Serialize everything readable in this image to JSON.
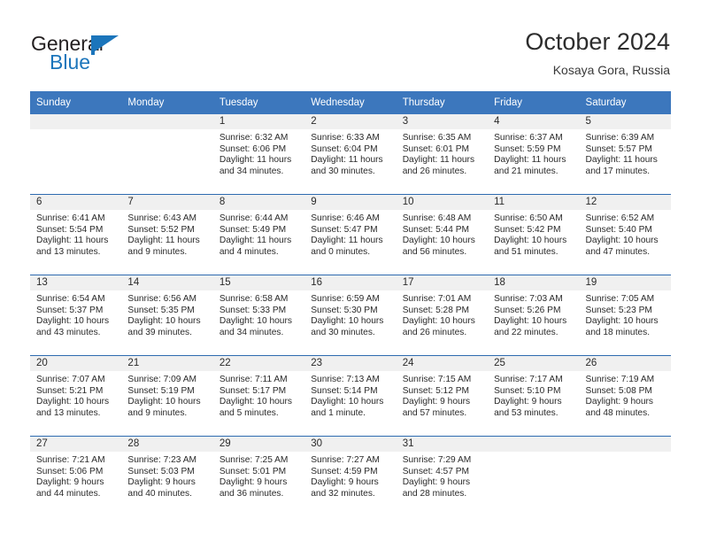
{
  "brand": {
    "name_top": "General",
    "name_bottom": "Blue",
    "flag_icon": "blue-flag-triangle",
    "color": "#1b75bb"
  },
  "header": {
    "title": "October 2024",
    "subtitle": "Kosaya Gora, Russia"
  },
  "theme": {
    "header_blue": "#3c77bd",
    "rule_blue": "#2e6bb0",
    "daynum_band": "#f0f0f0"
  },
  "weekday_headers": [
    "Sunday",
    "Monday",
    "Tuesday",
    "Wednesday",
    "Thursday",
    "Friday",
    "Saturday"
  ],
  "weeks": [
    [
      {
        "day": "",
        "empty": true
      },
      {
        "day": "",
        "empty": true
      },
      {
        "day": "1",
        "sunrise": "Sunrise: 6:32 AM",
        "sunset": "Sunset: 6:06 PM",
        "daylight": "Daylight: 11 hours and 34 minutes."
      },
      {
        "day": "2",
        "sunrise": "Sunrise: 6:33 AM",
        "sunset": "Sunset: 6:04 PM",
        "daylight": "Daylight: 11 hours and 30 minutes."
      },
      {
        "day": "3",
        "sunrise": "Sunrise: 6:35 AM",
        "sunset": "Sunset: 6:01 PM",
        "daylight": "Daylight: 11 hours and 26 minutes."
      },
      {
        "day": "4",
        "sunrise": "Sunrise: 6:37 AM",
        "sunset": "Sunset: 5:59 PM",
        "daylight": "Daylight: 11 hours and 21 minutes."
      },
      {
        "day": "5",
        "sunrise": "Sunrise: 6:39 AM",
        "sunset": "Sunset: 5:57 PM",
        "daylight": "Daylight: 11 hours and 17 minutes."
      }
    ],
    [
      {
        "day": "6",
        "sunrise": "Sunrise: 6:41 AM",
        "sunset": "Sunset: 5:54 PM",
        "daylight": "Daylight: 11 hours and 13 minutes."
      },
      {
        "day": "7",
        "sunrise": "Sunrise: 6:43 AM",
        "sunset": "Sunset: 5:52 PM",
        "daylight": "Daylight: 11 hours and 9 minutes."
      },
      {
        "day": "8",
        "sunrise": "Sunrise: 6:44 AM",
        "sunset": "Sunset: 5:49 PM",
        "daylight": "Daylight: 11 hours and 4 minutes."
      },
      {
        "day": "9",
        "sunrise": "Sunrise: 6:46 AM",
        "sunset": "Sunset: 5:47 PM",
        "daylight": "Daylight: 11 hours and 0 minutes."
      },
      {
        "day": "10",
        "sunrise": "Sunrise: 6:48 AM",
        "sunset": "Sunset: 5:44 PM",
        "daylight": "Daylight: 10 hours and 56 minutes."
      },
      {
        "day": "11",
        "sunrise": "Sunrise: 6:50 AM",
        "sunset": "Sunset: 5:42 PM",
        "daylight": "Daylight: 10 hours and 51 minutes."
      },
      {
        "day": "12",
        "sunrise": "Sunrise: 6:52 AM",
        "sunset": "Sunset: 5:40 PM",
        "daylight": "Daylight: 10 hours and 47 minutes."
      }
    ],
    [
      {
        "day": "13",
        "sunrise": "Sunrise: 6:54 AM",
        "sunset": "Sunset: 5:37 PM",
        "daylight": "Daylight: 10 hours and 43 minutes."
      },
      {
        "day": "14",
        "sunrise": "Sunrise: 6:56 AM",
        "sunset": "Sunset: 5:35 PM",
        "daylight": "Daylight: 10 hours and 39 minutes."
      },
      {
        "day": "15",
        "sunrise": "Sunrise: 6:58 AM",
        "sunset": "Sunset: 5:33 PM",
        "daylight": "Daylight: 10 hours and 34 minutes."
      },
      {
        "day": "16",
        "sunrise": "Sunrise: 6:59 AM",
        "sunset": "Sunset: 5:30 PM",
        "daylight": "Daylight: 10 hours and 30 minutes."
      },
      {
        "day": "17",
        "sunrise": "Sunrise: 7:01 AM",
        "sunset": "Sunset: 5:28 PM",
        "daylight": "Daylight: 10 hours and 26 minutes."
      },
      {
        "day": "18",
        "sunrise": "Sunrise: 7:03 AM",
        "sunset": "Sunset: 5:26 PM",
        "daylight": "Daylight: 10 hours and 22 minutes."
      },
      {
        "day": "19",
        "sunrise": "Sunrise: 7:05 AM",
        "sunset": "Sunset: 5:23 PM",
        "daylight": "Daylight: 10 hours and 18 minutes."
      }
    ],
    [
      {
        "day": "20",
        "sunrise": "Sunrise: 7:07 AM",
        "sunset": "Sunset: 5:21 PM",
        "daylight": "Daylight: 10 hours and 13 minutes."
      },
      {
        "day": "21",
        "sunrise": "Sunrise: 7:09 AM",
        "sunset": "Sunset: 5:19 PM",
        "daylight": "Daylight: 10 hours and 9 minutes."
      },
      {
        "day": "22",
        "sunrise": "Sunrise: 7:11 AM",
        "sunset": "Sunset: 5:17 PM",
        "daylight": "Daylight: 10 hours and 5 minutes."
      },
      {
        "day": "23",
        "sunrise": "Sunrise: 7:13 AM",
        "sunset": "Sunset: 5:14 PM",
        "daylight": "Daylight: 10 hours and 1 minute."
      },
      {
        "day": "24",
        "sunrise": "Sunrise: 7:15 AM",
        "sunset": "Sunset: 5:12 PM",
        "daylight": "Daylight: 9 hours and 57 minutes."
      },
      {
        "day": "25",
        "sunrise": "Sunrise: 7:17 AM",
        "sunset": "Sunset: 5:10 PM",
        "daylight": "Daylight: 9 hours and 53 minutes."
      },
      {
        "day": "26",
        "sunrise": "Sunrise: 7:19 AM",
        "sunset": "Sunset: 5:08 PM",
        "daylight": "Daylight: 9 hours and 48 minutes."
      }
    ],
    [
      {
        "day": "27",
        "sunrise": "Sunrise: 7:21 AM",
        "sunset": "Sunset: 5:06 PM",
        "daylight": "Daylight: 9 hours and 44 minutes."
      },
      {
        "day": "28",
        "sunrise": "Sunrise: 7:23 AM",
        "sunset": "Sunset: 5:03 PM",
        "daylight": "Daylight: 9 hours and 40 minutes."
      },
      {
        "day": "29",
        "sunrise": "Sunrise: 7:25 AM",
        "sunset": "Sunset: 5:01 PM",
        "daylight": "Daylight: 9 hours and 36 minutes."
      },
      {
        "day": "30",
        "sunrise": "Sunrise: 7:27 AM",
        "sunset": "Sunset: 4:59 PM",
        "daylight": "Daylight: 9 hours and 32 minutes."
      },
      {
        "day": "31",
        "sunrise": "Sunrise: 7:29 AM",
        "sunset": "Sunset: 4:57 PM",
        "daylight": "Daylight: 9 hours and 28 minutes."
      },
      {
        "day": "",
        "empty": true
      },
      {
        "day": "",
        "empty": true
      }
    ]
  ]
}
